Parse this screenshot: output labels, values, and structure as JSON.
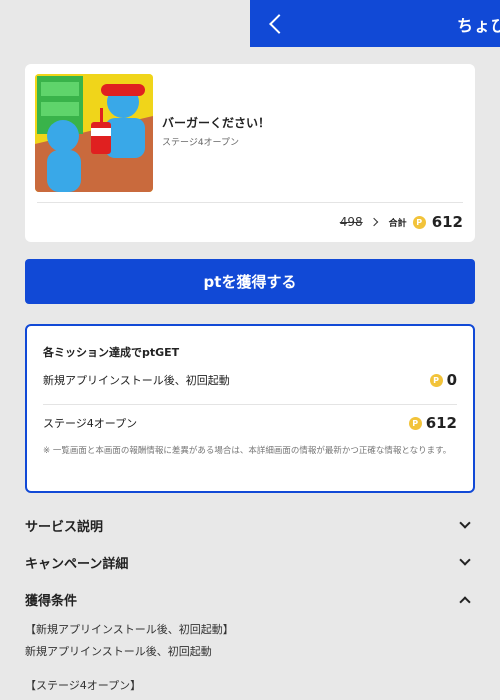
{
  "header": {
    "title": "ちょび"
  },
  "app": {
    "name": "バーガーください！",
    "subtitle": "ステージ4オープン",
    "old_points": "498",
    "total_label": "合計",
    "total_points": "612"
  },
  "cta": {
    "label": "ptを獲得する"
  },
  "missions": {
    "title": "各ミッション達成でptGET",
    "items": [
      {
        "label": "新規アプリインストール後、初回起動",
        "points": "0"
      },
      {
        "label": "ステージ4オープン",
        "points": "612"
      }
    ],
    "note": "※ 一覧画面と本画面の報酬情報に差異がある場合は、本詳細画面の情報が最新かつ正確な情報となります。"
  },
  "sections": [
    {
      "title": "サービス説明",
      "expanded": false
    },
    {
      "title": "キャンペーン詳細",
      "expanded": false
    },
    {
      "title": "獲得条件",
      "expanded": true
    }
  ],
  "conditions": [
    "【新規アプリインストール後、初回起動】",
    "新規アプリインストール後、初回起動",
    "【ステージ4オープン】"
  ],
  "coin_glyph": "P",
  "colors": {
    "primary": "#1149d6",
    "coin": "#f2c33a",
    "background": "#e8e8e8"
  }
}
